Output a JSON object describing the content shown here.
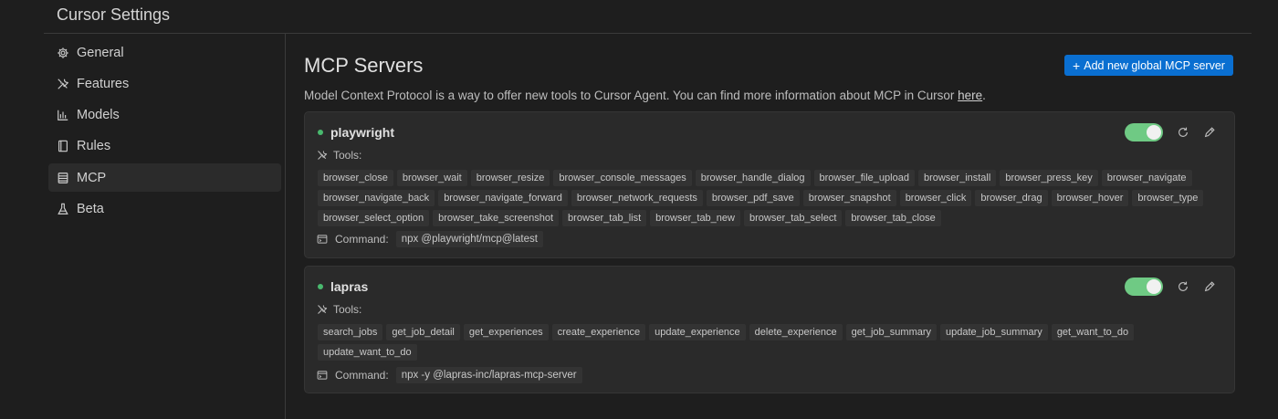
{
  "window": {
    "title": "Cursor Settings"
  },
  "sidebar": {
    "items": [
      {
        "label": "General",
        "icon": "gear-icon"
      },
      {
        "label": "Features",
        "icon": "tools-icon"
      },
      {
        "label": "Models",
        "icon": "bar-chart-icon"
      },
      {
        "label": "Rules",
        "icon": "document-icon"
      },
      {
        "label": "MCP",
        "icon": "server-icon",
        "active": true
      },
      {
        "label": "Beta",
        "icon": "flask-icon"
      }
    ]
  },
  "main": {
    "title": "MCP Servers",
    "add_button": {
      "plus": "+",
      "label": "Add new global MCP server"
    },
    "description": "Model Context Protocol is a way to offer new tools to Cursor Agent. You can find more information about MCP in Cursor ",
    "description_link": "here",
    "description_end": "."
  },
  "servers": [
    {
      "name": "playwright",
      "status_color": "#49b96e",
      "enabled": true,
      "tools_label": "Tools:",
      "tool_rows": [
        [
          "browser_close",
          "browser_wait",
          "browser_resize",
          "browser_console_messages",
          "browser_handle_dialog",
          "browser_file_upload",
          "browser_install",
          "browser_press_key",
          "browser_navigate"
        ],
        [
          "browser_navigate_back",
          "browser_navigate_forward",
          "browser_network_requests",
          "browser_pdf_save",
          "browser_snapshot",
          "browser_click",
          "browser_drag",
          "browser_hover",
          "browser_type"
        ],
        [
          "browser_select_option",
          "browser_take_screenshot",
          "browser_tab_list",
          "browser_tab_new",
          "browser_tab_select",
          "browser_tab_close"
        ]
      ],
      "command_label": "Command:",
      "command": "npx @playwright/mcp@latest"
    },
    {
      "name": "lapras",
      "status_color": "#49b96e",
      "enabled": true,
      "tools_label": "Tools:",
      "tool_rows": [
        [
          "search_jobs",
          "get_job_detail",
          "get_experiences",
          "create_experience",
          "update_experience",
          "delete_experience",
          "get_job_summary",
          "update_job_summary",
          "get_want_to_do"
        ],
        [
          "update_want_to_do"
        ]
      ],
      "command_label": "Command:",
      "command": "npx -y @lapras-inc/lapras-mcp-server"
    }
  ],
  "colors": {
    "accent": "#0a6fd1",
    "toggle_on": "#6fca84",
    "background": "#1e1e1e",
    "card": "#2a2a2a"
  }
}
